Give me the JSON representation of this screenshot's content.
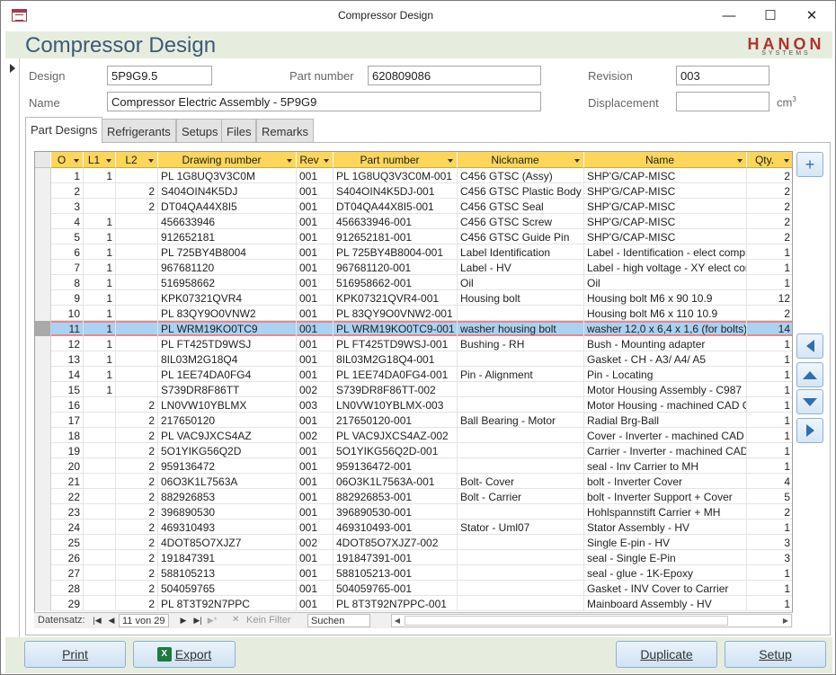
{
  "window": {
    "title": "Compressor Design"
  },
  "header": {
    "form_title": "Compressor Design",
    "logo_word": "HANON",
    "logo_sub": "SYSTEMS",
    "logo_color": "#b2322f"
  },
  "fields": {
    "design_label": "Design",
    "design_value": "5P9G9.5",
    "part_number_label": "Part number",
    "part_number_value": "620809086",
    "revision_label": "Revision",
    "revision_value": "003",
    "name_label": "Name",
    "name_value": "Compressor Electric Assembly - 5P9G9",
    "displacement_label": "Displacement",
    "displacement_value": "",
    "displacement_unit": "cm",
    "displacement_unit_exp": "3"
  },
  "tabs": [
    {
      "label": "Part Designs",
      "active": true
    },
    {
      "label": "Refrigerants",
      "active": false
    },
    {
      "label": "Setups",
      "active": false
    },
    {
      "label": "Files",
      "active": false
    },
    {
      "label": "Remarks",
      "active": false
    }
  ],
  "grid": {
    "columns": [
      "O",
      "L1",
      "L2",
      "Drawing number",
      "Rev",
      "Part number",
      "Nickname",
      "Name",
      "Qty."
    ],
    "header_color": "#fbd65b",
    "selected_row_color": "#a9d2f3",
    "selected_index": 10,
    "rows": [
      [
        "1",
        "1",
        "",
        "PL 1G8UQ3V3C0M",
        "001",
        "PL 1G8UQ3V3C0M-001",
        "C456 GTSC (Assy)",
        "SHP'G/CAP-MISC",
        "2"
      ],
      [
        "2",
        "",
        "2",
        "S404OIN4K5DJ",
        "001",
        "S404OIN4K5DJ-001",
        "C456 GTSC Plastic Body",
        "SHP'G/CAP-MISC",
        "2"
      ],
      [
        "3",
        "",
        "2",
        "DT04QA44X8I5",
        "001",
        "DT04QA44X8I5-001",
        "C456 GTSC Seal",
        "SHP'G/CAP-MISC",
        "2"
      ],
      [
        "4",
        "1",
        "",
        "456633946",
        "001",
        "456633946-001",
        "C456 GTSC Screw",
        "SHP'G/CAP-MISC",
        "2"
      ],
      [
        "5",
        "1",
        "",
        "912652181",
        "001",
        "912652181-001",
        "C456 GTSC Guide Pin",
        "SHP'G/CAP-MISC",
        "2"
      ],
      [
        "6",
        "1",
        "",
        "PL 725BY4B8004",
        "001",
        "PL 725BY4B8004-001",
        "Label Identification",
        "Label - Identification - elect compr",
        "1"
      ],
      [
        "7",
        "1",
        "",
        "967681120",
        "001",
        "967681120-001",
        "Label - HV",
        "Label - high voltage - XY elect compr",
        "1"
      ],
      [
        "8",
        "1",
        "",
        "516958662",
        "001",
        "516958662-001",
        "Oil",
        "Oil",
        "1"
      ],
      [
        "9",
        "1",
        "",
        "KPK07321QVR4",
        "001",
        "KPK07321QVR4-001",
        "Housing bolt",
        "Housing bolt M6 x 90 10.9",
        "12"
      ],
      [
        "10",
        "1",
        "",
        "PL 83QY9O0VNW2",
        "001",
        "PL 83QY9O0VNW2-001",
        "",
        "Housing bolt M6 x 110 10.9",
        "2"
      ],
      [
        "11",
        "1",
        "",
        "PL WRM19KO0TC9",
        "001",
        "PL WRM19KO0TC9-001",
        "washer housing bolt",
        "washer 12,0 x 6,4 x 1,6 (for bolts)",
        "14"
      ],
      [
        "12",
        "1",
        "",
        "PL FT425TD9WSJ",
        "001",
        "PL FT425TD9WSJ-001",
        "Bushing - RH",
        "Bush - Mounting adapter",
        "1"
      ],
      [
        "13",
        "1",
        "",
        "8IL03M2G18Q4",
        "001",
        "8IL03M2G18Q4-001",
        "",
        "Gasket - CH - A3/ A4/ A5",
        "1"
      ],
      [
        "14",
        "1",
        "",
        "PL 1EE74DA0FG4",
        "001",
        "PL 1EE74DA0FG4-001",
        "Pin - Alignment",
        "Pin - Locating",
        "1"
      ],
      [
        "15",
        "1",
        "",
        "S739DR8F86TT",
        "002",
        "S739DR8F86TT-002",
        "",
        "Motor Housing Assembly - C987",
        "1"
      ],
      [
        "16",
        "",
        "2",
        "LN0VW10YBLMX",
        "003",
        "LN0VW10YBLMX-003",
        "",
        "Motor Housing - machined CAD CAM",
        "1"
      ],
      [
        "17",
        "",
        "2",
        "217650120",
        "001",
        "217650120-001",
        "Ball Bearing - Motor",
        "Radial Brg-Ball",
        "1"
      ],
      [
        "18",
        "",
        "2",
        "PL VAC9JXCS4AZ",
        "002",
        "PL VAC9JXCS4AZ-002",
        "",
        "Cover - Inverter - machined CAD CAM",
        "1"
      ],
      [
        "19",
        "",
        "2",
        "5O1YIKG56Q2D",
        "001",
        "5O1YIKG56Q2D-001",
        "",
        "Carrier - Inverter - machined CAD CAM",
        "1"
      ],
      [
        "20",
        "",
        "2",
        "959136472",
        "001",
        "959136472-001",
        "",
        "seal - Inv Carrier to MH",
        "1"
      ],
      [
        "21",
        "",
        "2",
        "06O3K1L7563A",
        "001",
        "06O3K1L7563A-001",
        "Bolt-  Cover",
        "bolt - Inverter Cover",
        "4"
      ],
      [
        "22",
        "",
        "2",
        "882926853",
        "001",
        "882926853-001",
        "Bolt - Carrier",
        "bolt - Inverter Support + Cover",
        "5"
      ],
      [
        "23",
        "",
        "2",
        "396890530",
        "001",
        "396890530-001",
        "",
        "Hohlspannstift Carrier + MH",
        "2"
      ],
      [
        "24",
        "",
        "2",
        "469310493",
        "001",
        "469310493-001",
        "Stator - Uml07",
        "Stator Assembly - HV",
        "1"
      ],
      [
        "25",
        "",
        "2",
        "4DOT85O7XJZ7",
        "002",
        "4DOT85O7XJZ7-002",
        "",
        "Single E-pin - HV",
        "3"
      ],
      [
        "26",
        "",
        "2",
        "191847391",
        "001",
        "191847391-001",
        "",
        "seal - Single E-Pin",
        "3"
      ],
      [
        "27",
        "",
        "2",
        "588105213",
        "001",
        "588105213-001",
        "",
        "seal - glue - 1K-Epoxy",
        "1"
      ],
      [
        "28",
        "",
        "2",
        "504059765",
        "001",
        "504059765-001",
        "",
        "Gasket - INV Cover to Carrier",
        "1"
      ],
      [
        "29",
        "",
        "2",
        "PL 8T3T92N7PPC",
        "001",
        "PL 8T3T92N7PPC-001",
        "",
        "Mainboard Assembly - HV",
        "1"
      ]
    ]
  },
  "nav": {
    "label": "Datensatz:",
    "record": "11 von 29",
    "filter": "Kein Filter",
    "search": "Suchen"
  },
  "footer": {
    "print_label": "Print",
    "export_label": "Export",
    "duplicate_label": "Duplicate",
    "setup_label": "Setup"
  }
}
